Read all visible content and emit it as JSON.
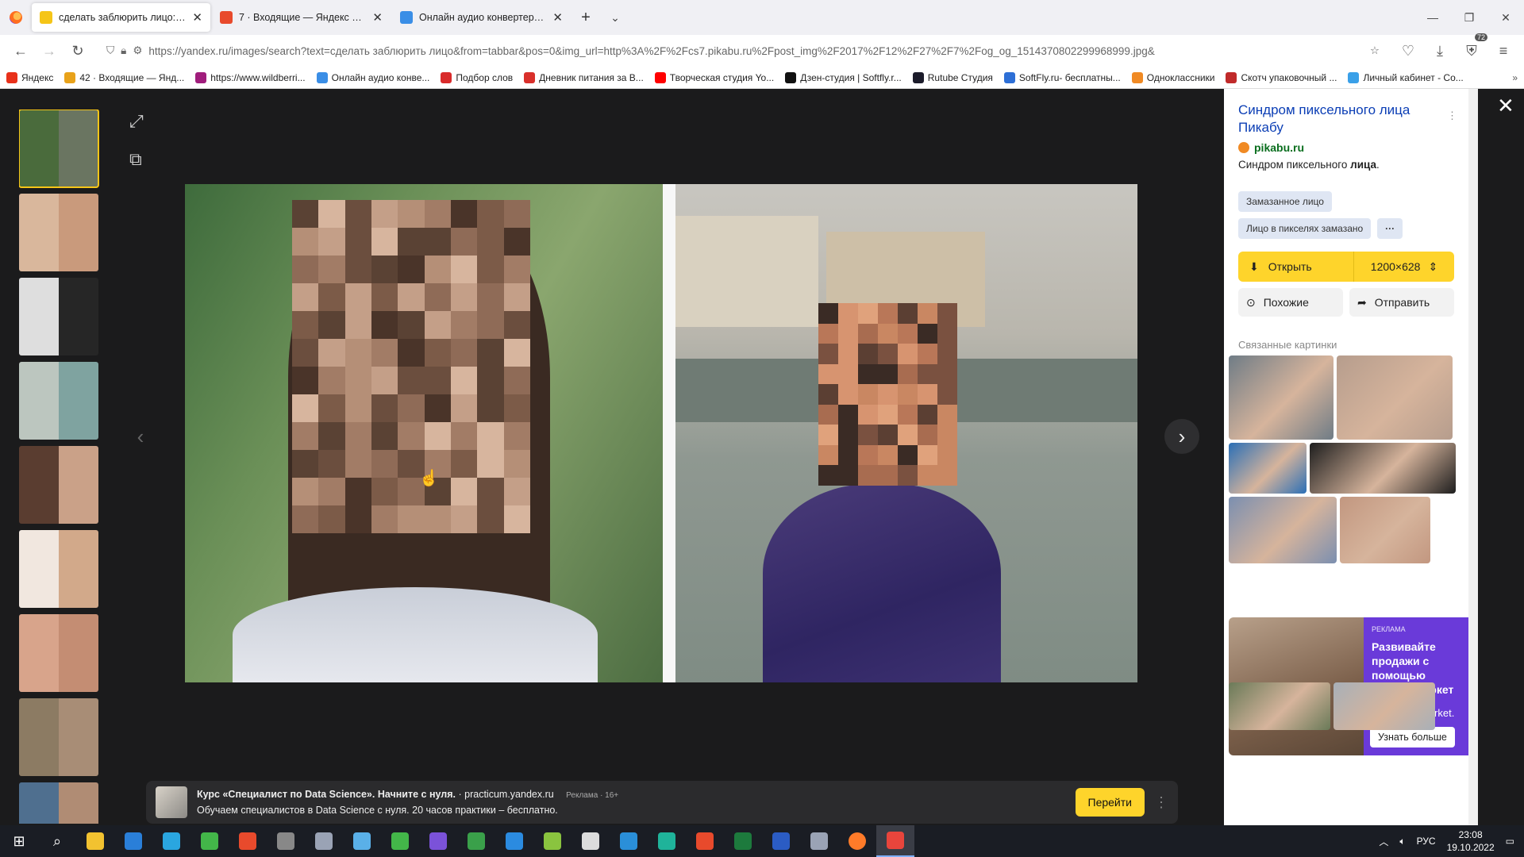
{
  "browser": {
    "tabs": [
      {
        "title": "сделать заблюрить лицо: 2 ть",
        "color": "#f5c518",
        "active": true
      },
      {
        "title": "7 · Входящие — Яндекс Почта",
        "color": "#e84a2c",
        "active": false
      },
      {
        "title": "Онлайн аудио конвертер - ко",
        "color": "#3a8ee6",
        "active": false
      }
    ],
    "new_tab": "+",
    "url": "https://yandex.ru/images/search?text=сделать заблюрить лицо&from=tabbar&pos=0&img_url=http%3A%2F%2Fcs7.pikabu.ru%2Fpost_img%2F2017%2F12%2F27%2F7%2Fog_og_1514370802299968999.jpg&",
    "ext_badge": "72"
  },
  "bookmarks": [
    {
      "label": "Яндекс",
      "color": "#e8311a"
    },
    {
      "label": "42 · Входящие — Янд...",
      "color": "#e8a21a"
    },
    {
      "label": "https://www.wildberri...",
      "color": "#a01d7c"
    },
    {
      "label": "Онлайн аудио конве...",
      "color": "#3a8ee6"
    },
    {
      "label": "Подбор слов",
      "color": "#d92b2b"
    },
    {
      "label": "Дневник питания за В...",
      "color": "#d9302b"
    },
    {
      "label": "Творческая студия Yo...",
      "color": "#ff0000"
    },
    {
      "label": "Дзен-студия | Softfly.r...",
      "color": "#111111"
    },
    {
      "label": "Rutube Студия",
      "color": "#1c1c2b"
    },
    {
      "label": "SoftFly.ru- бесплатны...",
      "color": "#2d6fd6"
    },
    {
      "label": "Одноклассники",
      "color": "#f08a24"
    },
    {
      "label": "Скотч упаковочный ...",
      "color": "#c02a2a"
    },
    {
      "label": "Личный кабинет - Со...",
      "color": "#3aa0e8"
    }
  ],
  "viewer": {
    "thumbnails": [
      {
        "a": "#4a6b3c",
        "b": "#6a7561"
      },
      {
        "a": "#d9b79c",
        "b": "#c99a7c"
      },
      {
        "a": "#dedede",
        "b": "#262626"
      },
      {
        "a": "#bcc6bf",
        "b": "#7fa3a0"
      },
      {
        "a": "#5a3d30",
        "b": "#caa188"
      },
      {
        "a": "#f1e7df",
        "b": "#d2a98a"
      },
      {
        "a": "#d8a48b",
        "b": "#c48d73"
      },
      {
        "a": "#8c7b63",
        "b": "#a88d76"
      },
      {
        "a": "#4f6f8f",
        "b": "#b08c74"
      }
    ],
    "prev": "‹",
    "next": "›"
  },
  "ad_bar": {
    "title": "Курс «Специалист по Data Science». Начните с нуля.",
    "domain": "· practicum.yandex.ru",
    "label": "Реклама · 16+",
    "text": "Обучаем специалистов в Data Science с нуля. 20 часов практики – бесплатно.",
    "button": "Перейти"
  },
  "panel": {
    "title": "Синдром пиксельного лица Пикабу",
    "domain": "pikabu.ru",
    "desc_plain": "Синдром пиксельного ",
    "desc_bold": "лица",
    "desc_end": ".",
    "tags": [
      "Замазанное лицо",
      "Лицо в пикселях замазано"
    ],
    "tags_more": "···",
    "open_label": "Открыть",
    "size_label": "1200×628",
    "similar_label": "Похожие",
    "share_label": "Отправить",
    "related_heading": "Связанные картинки",
    "related_colors": [
      "#6f7c86",
      "#b69d8d",
      "#2b6fb6",
      "#1e1e1e",
      "#7b8fb0",
      "#c29780",
      "#6a7a58",
      "#a8b0b8"
    ],
    "ad": {
      "label": "РЕКЛАМА",
      "headline": "Развивайте продажи с помощью Яндекс Маркет",
      "partner": "partner.market.",
      "cta": "Узнать больше"
    }
  },
  "taskbar": {
    "apps": [
      "#f2c230",
      "#2a7fd9",
      "#2aa6e0",
      "#43b649",
      "#e84a2c",
      "#888888",
      "#9aa3b5",
      "#5ab0e8",
      "#43b649",
      "#7b52d9",
      "#3aa04a",
      "#2b8be0",
      "#8ac43f",
      "#dcdcdc",
      "#2a8fd9",
      "#1fb39a",
      "#e84a2c",
      "#1d7a3d",
      "#2b5cc4",
      "#9aa3b5",
      "#ff7b29",
      "#e8453c"
    ],
    "lang": "РУС",
    "time": "23:08",
    "date": "19.10.2022"
  }
}
